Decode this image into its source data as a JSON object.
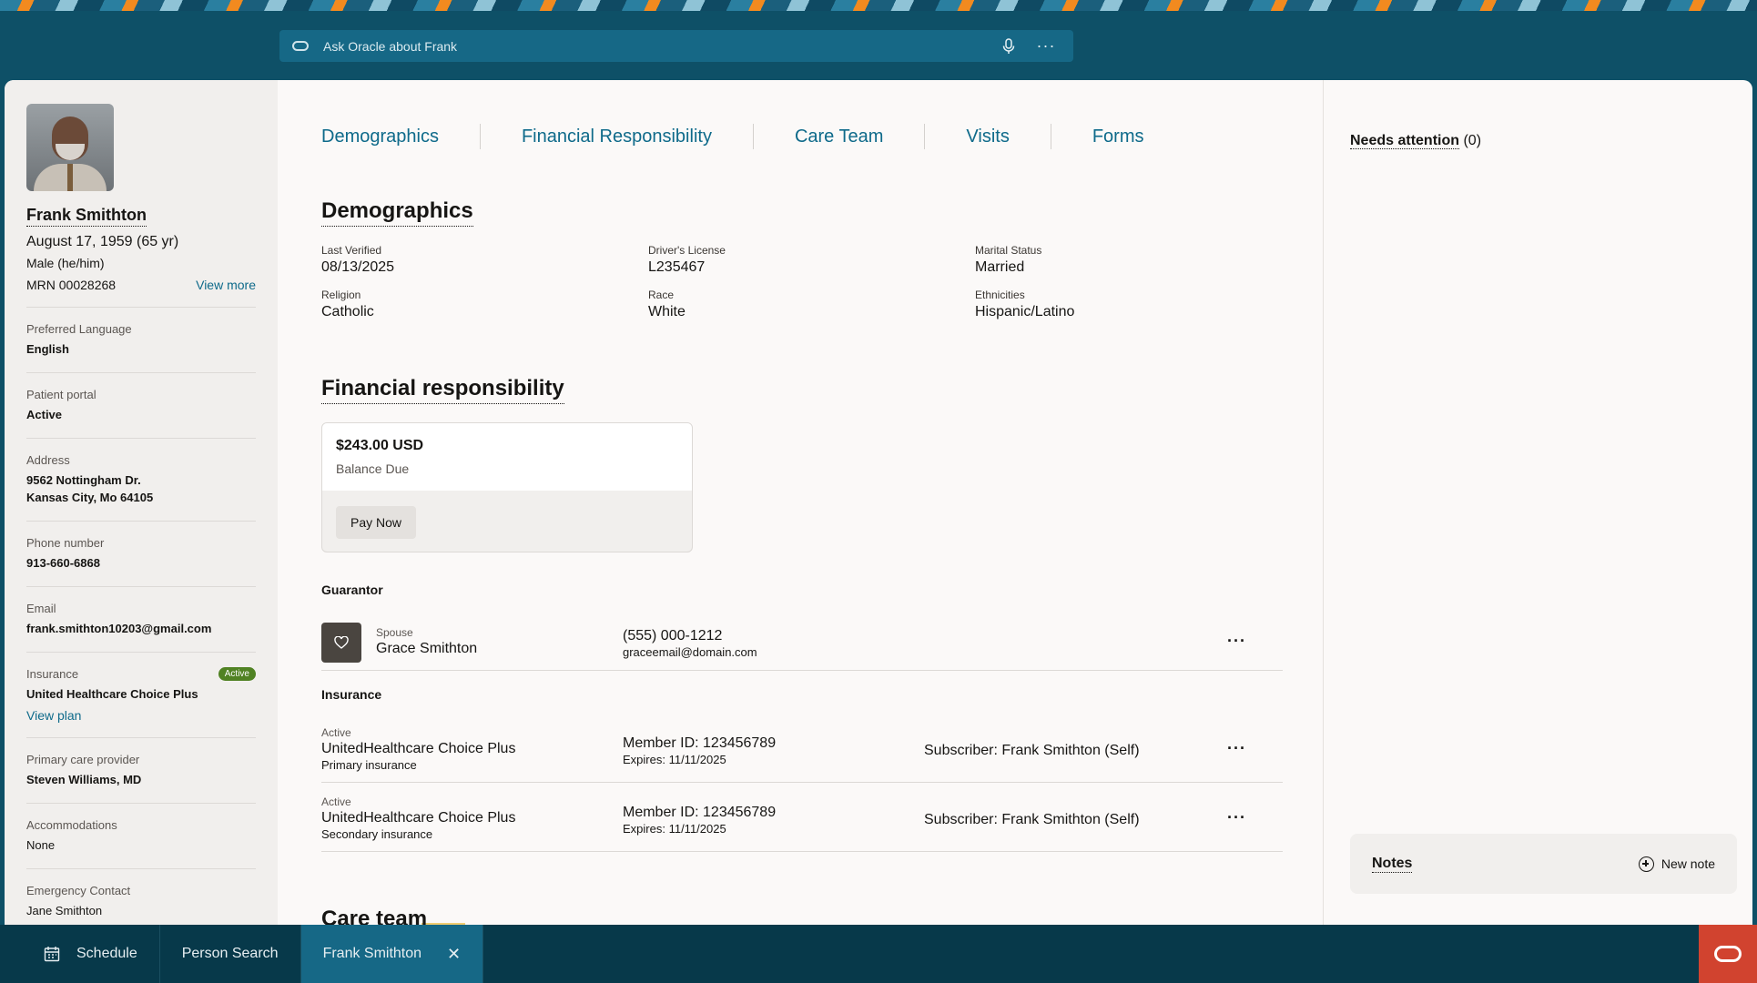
{
  "header": {
    "ask_placeholder": "Ask Oracle about Frank",
    "more_label": "···"
  },
  "patient": {
    "name": "Frank Smithton",
    "dob": "August 17, 1959 (65 yr)",
    "gender": "Male (he/him)",
    "mrn": "MRN 00028268",
    "view_more": "View more"
  },
  "sidebar": {
    "preferred_language": {
      "label": "Preferred Language",
      "value": "English"
    },
    "patient_portal": {
      "label": "Patient portal",
      "value": "Active"
    },
    "address": {
      "label": "Address",
      "line1": "9562 Nottingham Dr.",
      "line2": "Kansas City, Mo 64105"
    },
    "phone": {
      "label": "Phone number",
      "value": "913-660-6868"
    },
    "email": {
      "label": "Email",
      "value": "frank.smithton10203@gmail.com"
    },
    "insurance": {
      "label": "Insurance",
      "badge": "Active",
      "value": "United Healthcare Choice Plus",
      "link": "View plan"
    },
    "pcp": {
      "label": "Primary care provider",
      "value": "Steven Williams, MD"
    },
    "accommodations": {
      "label": "Accommodations",
      "value": "None"
    },
    "emergency": {
      "label": "Emergency Contact",
      "value": "Jane Smithton"
    }
  },
  "tabs": [
    "Demographics",
    "Financial Responsibility",
    "Care Team",
    "Visits",
    "Forms"
  ],
  "demographics": {
    "title": "Demographics",
    "fields": [
      {
        "label": "Last Verified",
        "value": "08/13/2025"
      },
      {
        "label": "Driver's License",
        "value": "L235467"
      },
      {
        "label": "Marital Status",
        "value": "Married"
      },
      {
        "label": "Religion",
        "value": "Catholic"
      },
      {
        "label": "Race",
        "value": "White"
      },
      {
        "label": "Ethnicities",
        "value": "Hispanic/Latino"
      }
    ]
  },
  "financial": {
    "title": "Financial responsibility",
    "amount": "$243.00 USD",
    "balance_label": "Balance Due",
    "pay_label": "Pay Now",
    "guarantor_title": "Guarantor",
    "guarantor": {
      "relation": "Spouse",
      "name": "Grace Smithton",
      "phone": "(555) 000-1212",
      "email": "graceemail@domain.com"
    },
    "insurance_title": "Insurance",
    "insurances": [
      {
        "status": "Active",
        "plan": "UnitedHealthcare Choice Plus",
        "type": "Primary insurance",
        "member": "Member ID: 123456789",
        "expires": "Expires: 11/11/2025",
        "subscriber": "Subscriber: Frank Smithton (Self)"
      },
      {
        "status": "Active",
        "plan": "UnitedHealthcare Choice Plus",
        "type": "Secondary insurance",
        "member": "Member ID: 123456789",
        "expires": "Expires: 11/11/2025",
        "subscriber": "Subscriber: Frank Smithton (Self)"
      }
    ]
  },
  "care_team_title": "Care team",
  "right_panel": {
    "needs_attention": "Needs attention",
    "needs_count": "(0)",
    "notes_title": "Notes",
    "new_note": "New note"
  },
  "taskbar": {
    "schedule": "Schedule",
    "person_search": "Person Search",
    "active_tab": "Frank Smithton"
  },
  "colors": {
    "brand_teal": "#0e5067",
    "link": "#0e6a8a",
    "oracle_red": "#d1432f",
    "active_badge": "#508223"
  }
}
